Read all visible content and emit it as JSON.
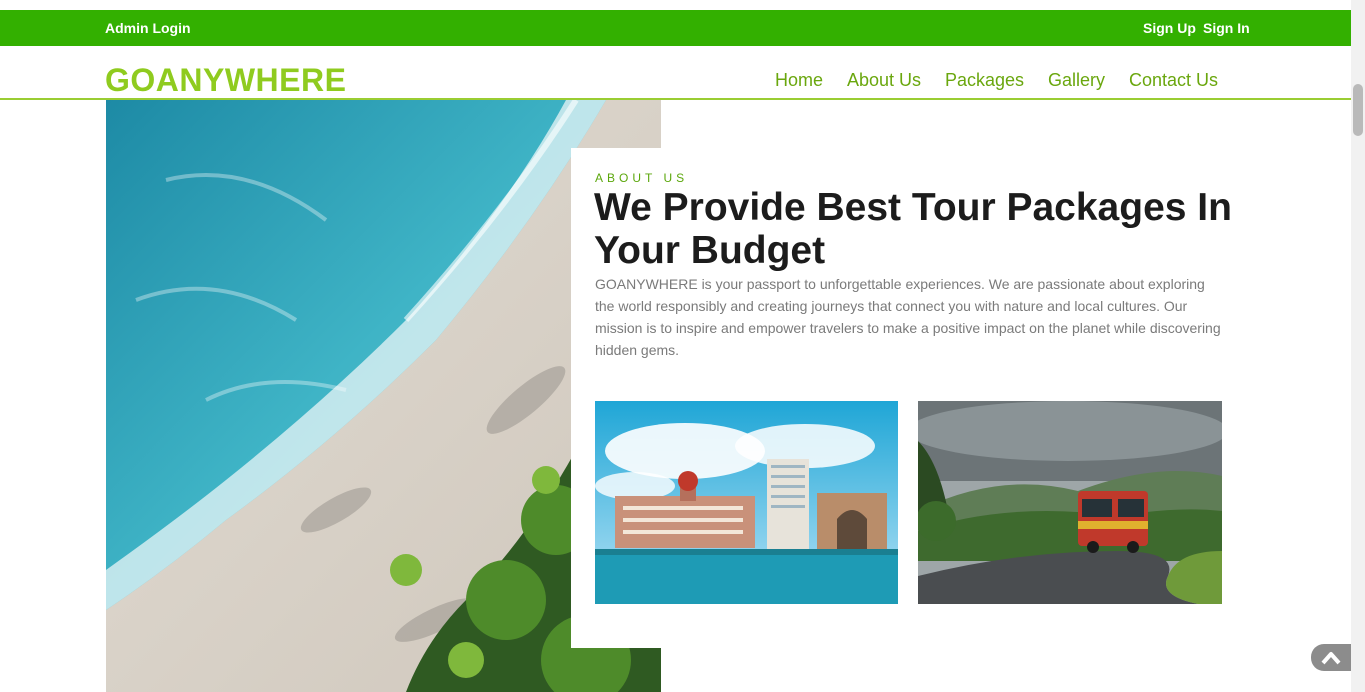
{
  "topbar": {
    "admin_login": "Admin Login",
    "sign_up": "Sign Up",
    "sign_in": "Sign In",
    "color": "#33b000"
  },
  "header": {
    "brand": "GOANYWHERE",
    "nav": [
      "Home",
      "About Us",
      "Packages",
      "Gallery",
      "Contact Us"
    ],
    "accent_color": "#8fcb1f"
  },
  "about": {
    "eyebrow": "ABOUT US",
    "title": "We Provide Best Tour Packages In Your Budget",
    "description": "GOANYWHERE is your passport to unforgettable experiences. We are passionate about exploring the world responsibly and creating journeys that connect you with nature and local cultures. Our mission is to inspire and empower travelers to make a positive impact on the planet while discovering hidden gems."
  },
  "icons": {
    "back_to_top": "chevron-up-icon"
  }
}
